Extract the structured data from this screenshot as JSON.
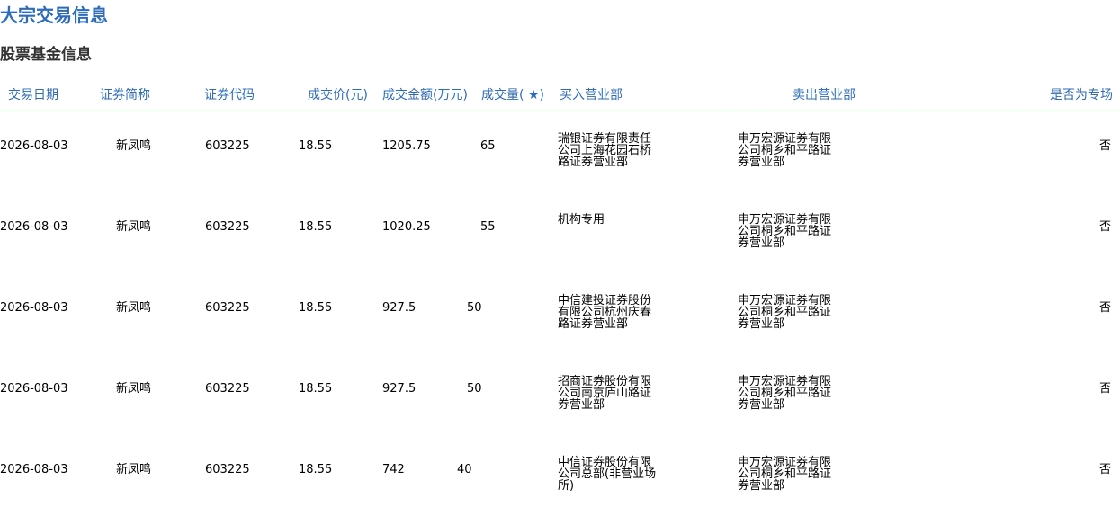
{
  "page": {
    "title": "大宗交易信息",
    "subtitle": "股票基金信息"
  },
  "table": {
    "headers": [
      "交易日期",
      "证券简称",
      "证券代码",
      "成交价(元)",
      "成交金额(万元)",
      "成交量( ★)",
      "买入营业部",
      "卖出营业部",
      "是否为专场"
    ],
    "rows": [
      {
        "date": "2026-08-03",
        "name": "新凤鸣",
        "code": "603225",
        "price": "18.55",
        "amount": "1205.75",
        "volume": "65",
        "buyer": "瑞银证券有限责任公司上海花园石桥路证券营业部",
        "seller": "申万宏源证券有限公司桐乡和平路证券营业部",
        "special": "否"
      },
      {
        "date": "2026-08-03",
        "name": "新凤鸣",
        "code": "603225",
        "price": "18.55",
        "amount": "1020.25",
        "volume": "55",
        "buyer": "机构专用",
        "seller": "申万宏源证券有限公司桐乡和平路证券营业部",
        "special": "否"
      },
      {
        "date": "2026-08-03",
        "name": "新凤鸣",
        "code": "603225",
        "price": "18.55",
        "amount": "927.5",
        "volume": "50",
        "buyer": "中信建投证券股份有限公司杭州庆春路证券营业部",
        "seller": "申万宏源证券有限公司桐乡和平路证券营业部",
        "special": "否"
      },
      {
        "date": "2026-08-03",
        "name": "新凤鸣",
        "code": "603225",
        "price": "18.55",
        "amount": "927.5",
        "volume": "50",
        "buyer": "招商证券股份有限公司南京庐山路证券营业部",
        "seller": "申万宏源证券有限公司桐乡和平路证券营业部",
        "special": "否"
      },
      {
        "date": "2026-08-03",
        "name": "新凤鸣",
        "code": "603225",
        "price": "18.55",
        "amount": "742",
        "volume": "40",
        "buyer": "中信证券股份有限公司总部(非营业场所)",
        "seller": "申万宏源证券有限公司桐乡和平路证券营业部",
        "special": "否"
      }
    ]
  }
}
